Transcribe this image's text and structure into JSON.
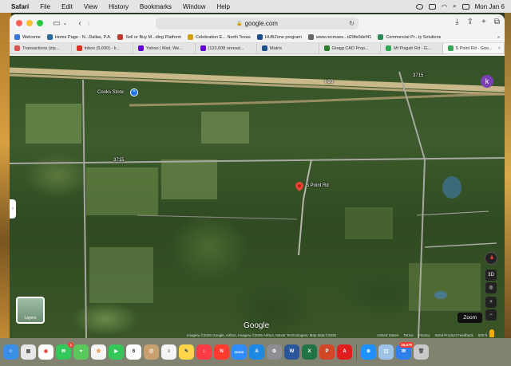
{
  "menubar": {
    "app": "Safari",
    "items": [
      "File",
      "Edit",
      "View",
      "History",
      "Bookmarks",
      "Window",
      "Help"
    ],
    "clock": "Mon Jan 6"
  },
  "toolbar": {
    "url": "google.com"
  },
  "bookmarks": [
    {
      "label": "Welcome",
      "color": "#3a78d8"
    },
    {
      "label": "Home Page - N...Dallas, P.A.",
      "color": "#2b6aa0"
    },
    {
      "label": "Sell or Buy M...ding Platform",
      "color": "#c0392b"
    },
    {
      "label": "Celebration E... North Texas",
      "color": "#d4a017"
    },
    {
      "label": "HUBZone program",
      "color": "#1f4e8c"
    },
    {
      "label": "www.recmaes...d29fe0def41",
      "color": "#666666"
    },
    {
      "label": "Commercial Pr...ty Solutions",
      "color": "#2e8b57"
    }
  ],
  "tabs": [
    {
      "label": "Transactions (zip...",
      "color": "#d9534f"
    },
    {
      "label": "Inbox (5,690) - k...",
      "color": "#d93025"
    },
    {
      "label": "Yahoo | Mail, We...",
      "color": "#6001d2"
    },
    {
      "label": "(133,608 unread...",
      "color": "#6001d2"
    },
    {
      "label": "Matrix",
      "color": "#1f4e8c"
    },
    {
      "label": "Gregg CAD Prop...",
      "color": "#2e7d32"
    },
    {
      "label": "Mt Pisgah Rd - G...",
      "color": "#34a853"
    },
    {
      "label": "S Point Rd - Goo...",
      "color": "#34a853"
    }
  ],
  "map": {
    "labels": {
      "business": "Cooks Store",
      "road_highway": "I-20",
      "road_fm": "3715",
      "road_fm2": "3715",
      "pin_label": "S Point Rd"
    },
    "avatar_letter": "k",
    "layers_label": "Layers",
    "zoom_tooltip": "Zoom",
    "view_3d": "3D",
    "logo": "Google",
    "attribution": "Imagery ©2025 Google, Airbus, Imagery ©2025 Airbus, Maxar Technologies, Map data ©2025",
    "footer_links": [
      "United States",
      "Terms",
      "Privacy",
      "Send Product Feedback",
      "500 ft"
    ]
  },
  "dock": [
    {
      "name": "finder",
      "color": "#3a8ee6",
      "glyph": "☺"
    },
    {
      "name": "launchpad",
      "color": "#e8e8e8",
      "glyph": "▦"
    },
    {
      "name": "chrome",
      "color": "#ffffff",
      "glyph": "◉"
    },
    {
      "name": "messages",
      "color": "#34c759",
      "glyph": "✉",
      "badge": "1"
    },
    {
      "name": "maps",
      "color": "#5ac85a",
      "glyph": "⌖"
    },
    {
      "name": "photos",
      "color": "#f5f5f5",
      "glyph": "✿"
    },
    {
      "name": "facetime",
      "color": "#34c759",
      "glyph": "▶"
    },
    {
      "name": "calendar",
      "color": "#ffffff",
      "glyph": "6"
    },
    {
      "name": "contacts",
      "color": "#c8a070",
      "glyph": "@"
    },
    {
      "name": "reminders",
      "color": "#f5f5f5",
      "glyph": "≡"
    },
    {
      "name": "notes",
      "color": "#ffd54a",
      "glyph": "✎"
    },
    {
      "name": "music",
      "color": "#fc3c44",
      "glyph": "♪"
    },
    {
      "name": "news",
      "color": "#ff3b30",
      "glyph": "N"
    },
    {
      "name": "zoom",
      "color": "#2d8cff",
      "glyph": "zoom"
    },
    {
      "name": "app-store",
      "color": "#1e88e5",
      "glyph": "A"
    },
    {
      "name": "settings",
      "color": "#8e8e93",
      "glyph": "⚙"
    },
    {
      "name": "word",
      "color": "#2b579a",
      "glyph": "W"
    },
    {
      "name": "excel",
      "color": "#217346",
      "glyph": "X"
    },
    {
      "name": "powerpoint",
      "color": "#d24726",
      "glyph": "P"
    },
    {
      "name": "acrobat",
      "color": "#e01e1e",
      "glyph": "A"
    },
    {
      "name": "safari",
      "color": "#1e90ff",
      "glyph": "⊕"
    },
    {
      "name": "preview",
      "color": "#9fc3e7",
      "glyph": "◫"
    },
    {
      "name": "mail",
      "color": "#2f80ed",
      "glyph": "✉",
      "badge": "26,079"
    },
    {
      "name": "trash",
      "color": "#c9c9c9",
      "glyph": "🗑"
    }
  ]
}
